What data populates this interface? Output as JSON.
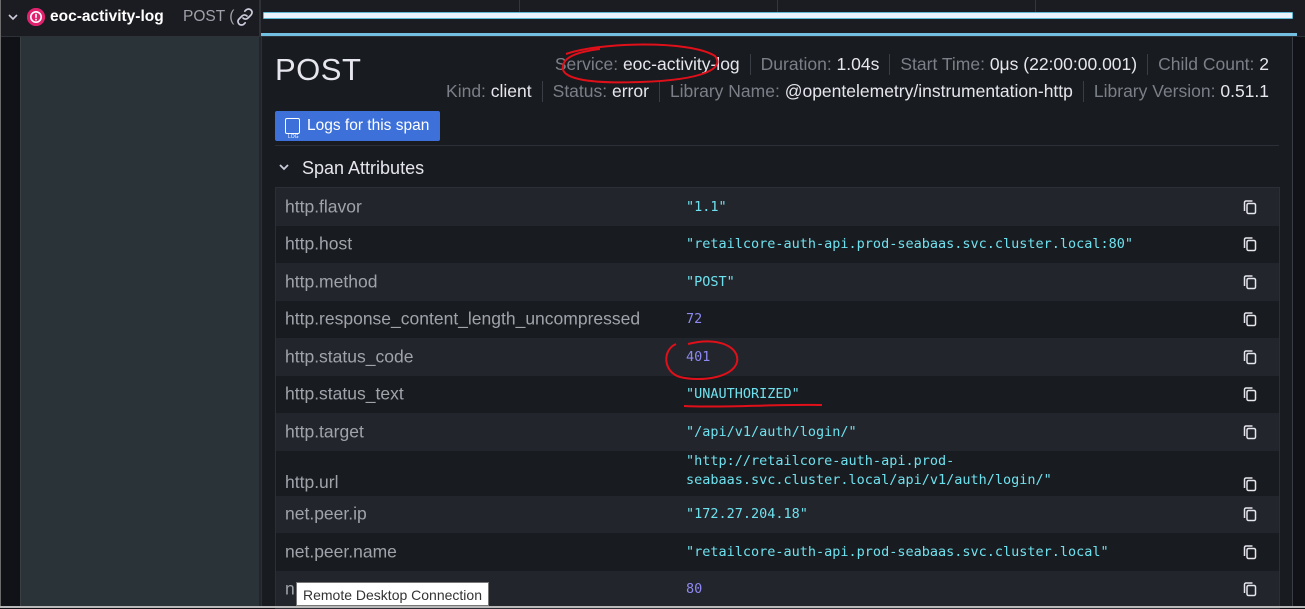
{
  "span_row": {
    "service": "eoc-activity-log",
    "operation": "POST (",
    "status_color": "#e0226e"
  },
  "detail": {
    "title": "POST",
    "meta_row1": [
      {
        "label": "Service: ",
        "value": "eoc-activity-log"
      },
      {
        "label": "Duration: ",
        "value": "1.04s"
      },
      {
        "label": "Start Time: ",
        "value": "0μs (22:00:00.001)"
      },
      {
        "label": "Child Count: ",
        "value": "2"
      }
    ],
    "meta_row2": [
      {
        "label": "Kind: ",
        "value": "client"
      },
      {
        "label": "Status: ",
        "value": "error"
      },
      {
        "label": "Library Name: ",
        "value": "@opentelemetry/instrumentation-http"
      },
      {
        "label": "Library Version: ",
        "value": "0.51.1"
      }
    ],
    "logs_button": "Logs for this span",
    "section_title": "Span Attributes",
    "attributes": [
      {
        "key": "http.flavor",
        "value": "\"1.1\"",
        "type": "str"
      },
      {
        "key": "http.host",
        "value": "\"retailcore-auth-api.prod-seabaas.svc.cluster.local:80\"",
        "type": "str"
      },
      {
        "key": "http.method",
        "value": "\"POST\"",
        "type": "str"
      },
      {
        "key": "http.response_content_length_uncompressed",
        "value": "72",
        "type": "num"
      },
      {
        "key": "http.status_code",
        "value": "401",
        "type": "num"
      },
      {
        "key": "http.status_text",
        "value": "\"UNAUTHORIZED\"",
        "type": "str"
      },
      {
        "key": "http.target",
        "value": "\"/api/v1/auth/login/\"",
        "type": "str"
      },
      {
        "key": "http.url",
        "value": "\"http://retailcore-auth-api.prod-seabaas.svc.cluster.local/api/v1/auth/login/\"",
        "type": "str"
      },
      {
        "key": "net.peer.ip",
        "value": "\"172.27.204.18\"",
        "type": "str"
      },
      {
        "key": "net.peer.name",
        "value": "\"retailcore-auth-api.prod-seabaas.svc.cluster.local\"",
        "type": "str"
      },
      {
        "key": "n",
        "value": "80",
        "type": "num"
      }
    ]
  },
  "tooltip": "Remote Desktop Connection",
  "colors": {
    "accent_button": "#3d71d9",
    "string_value": "#6fe1ee",
    "number_value": "#8d89f0",
    "annotation": "#e0101a"
  }
}
